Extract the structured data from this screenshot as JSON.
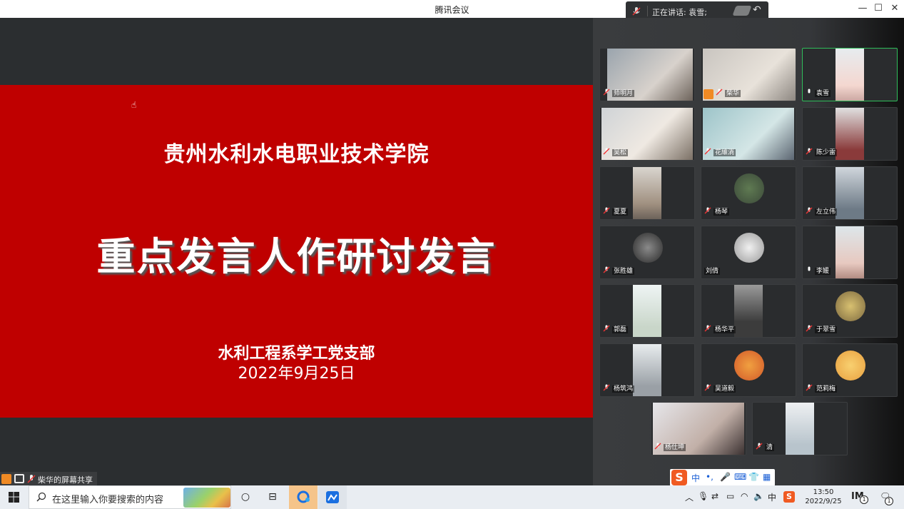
{
  "window": {
    "title": "腾讯会议",
    "speaking_label": "正在讲话: 袁雪;",
    "controls": {
      "minimize": "—",
      "maximize": "☐",
      "close": "✕"
    }
  },
  "slide": {
    "school": "贵州水利水电职业技术学院",
    "title": "重点发言人作研讨发言",
    "department": "水利工程系学工党支部",
    "date": "2022年9月25日",
    "bg_color": "#bf0000"
  },
  "share_label": "柴华的屏幕共享",
  "participants": [
    {
      "name": "师明月",
      "mic": "muted"
    },
    {
      "name": "柴华",
      "mic": "muted",
      "host": true
    },
    {
      "name": "袁雪",
      "mic": "on",
      "active": true
    },
    {
      "name": "吴松",
      "mic": "muted"
    },
    {
      "name": "花維淌",
      "mic": "muted"
    },
    {
      "name": "陈少雷",
      "mic": "muted"
    },
    {
      "name": "夏夏",
      "mic": "muted"
    },
    {
      "name": "杨琴",
      "mic": "muted"
    },
    {
      "name": "左立伟",
      "mic": "muted"
    },
    {
      "name": "张胜雄",
      "mic": "muted"
    },
    {
      "name": "刘倩",
      "mic": "none"
    },
    {
      "name": "李媛",
      "mic": "on"
    },
    {
      "name": "郭磊",
      "mic": "muted"
    },
    {
      "name": "杨华平",
      "mic": "muted"
    },
    {
      "name": "于翠雪",
      "mic": "muted"
    },
    {
      "name": "杨筑鸿",
      "mic": "muted"
    },
    {
      "name": "吴道毅",
      "mic": "muted"
    },
    {
      "name": "范莉梅",
      "mic": "muted"
    },
    {
      "name": "杨仕坤",
      "mic": "muted"
    },
    {
      "name": "清",
      "mic": "muted"
    }
  ],
  "ime": {
    "logo": "S",
    "mode": "中",
    "punct": "•,"
  },
  "taskbar": {
    "search_placeholder": "在这里输入你要搜索的内容",
    "time": "13:50",
    "date": "2022/9/25",
    "ime_indicator": "中",
    "notification_count": "1",
    "app_badge": "1"
  }
}
